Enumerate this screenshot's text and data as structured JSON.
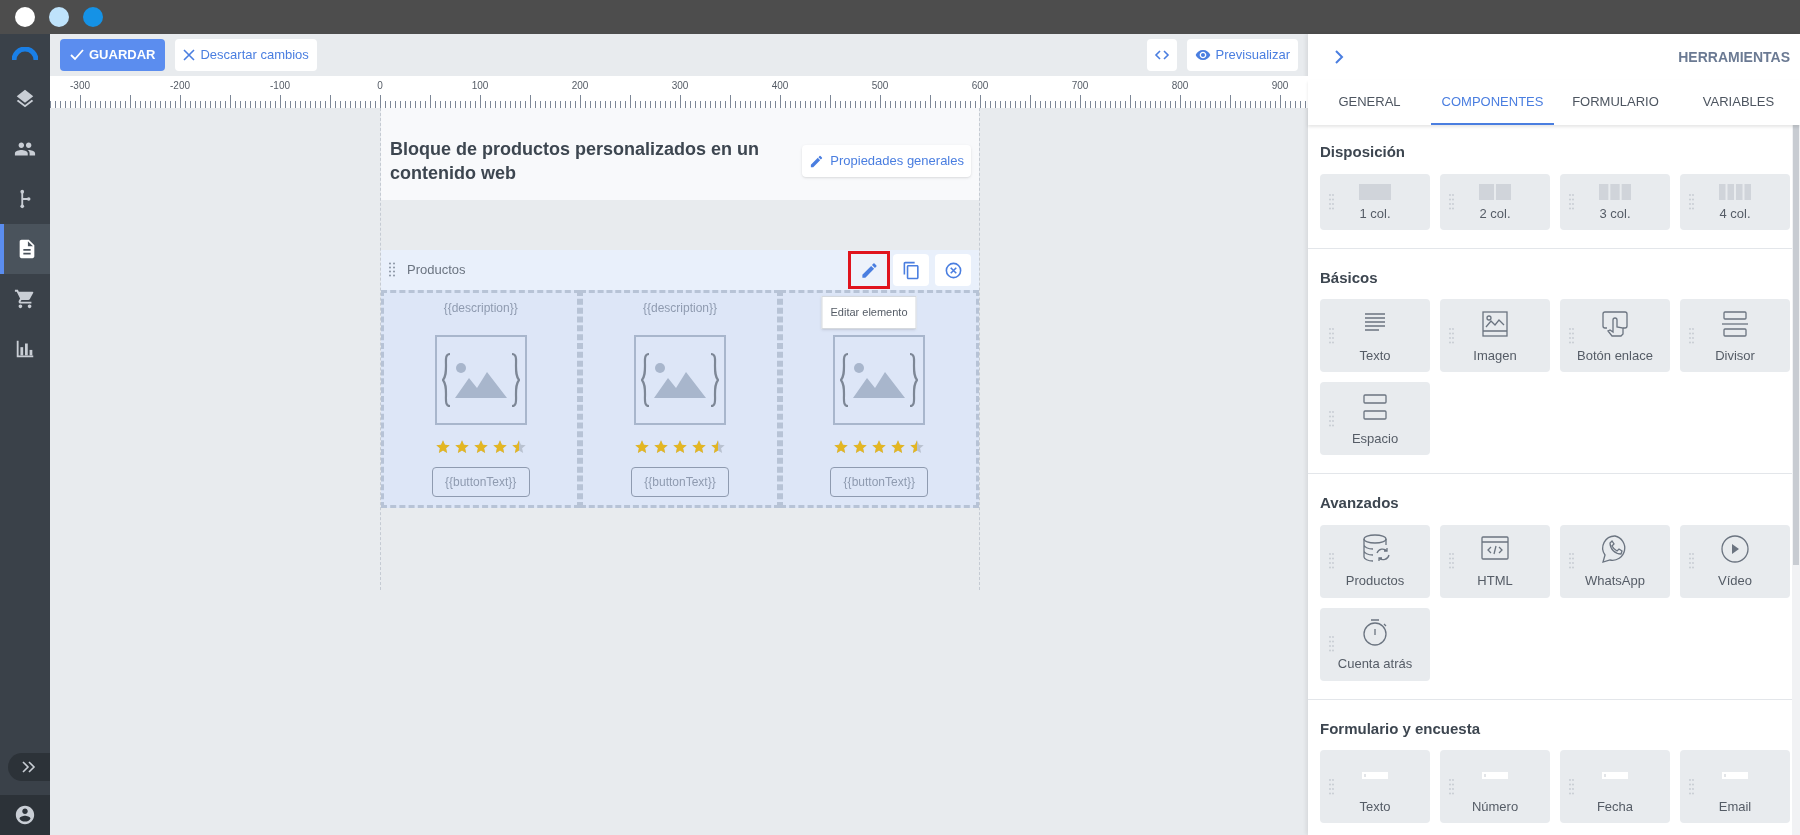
{
  "sidebar": {
    "items": [
      {
        "selected": false
      },
      {
        "selected": false
      },
      {
        "selected": false
      },
      {
        "selected": true
      },
      {
        "selected": false
      },
      {
        "selected": false
      }
    ]
  },
  "toolbar": {
    "save": "GUARDAR",
    "discard": "Descartar cambios",
    "preview": "Previsualizar"
  },
  "ruler": {
    "labels": [
      "-300",
      "-200",
      "-100",
      "0",
      "100",
      "200",
      "300",
      "400",
      "500",
      "600",
      "700",
      "800",
      "900"
    ]
  },
  "page": {
    "title": "Bloque de productos personalizados en un contenido web",
    "properties_button": "Propiedades generales",
    "element": {
      "label": "Productos",
      "tooltip": "Editar elemento",
      "actions": [
        {
          "kind": "edit",
          "highlighted": true
        },
        {
          "kind": "copy",
          "highlighted": false
        },
        {
          "kind": "delete",
          "highlighted": false
        }
      ],
      "products": [
        {
          "description": "{{description}}",
          "stars": 4.5,
          "button": "{{buttonText}}"
        },
        {
          "description": "{{description}}",
          "stars": 4.5,
          "button": "{{buttonText}}"
        },
        {
          "stars": 4.5,
          "button": "{{buttonText}}"
        }
      ]
    }
  },
  "panel": {
    "title": "HERRAMIENTAS",
    "tabs": [
      {
        "label": "GENERAL",
        "selected": false
      },
      {
        "label": "COMPONENTES",
        "selected": true
      },
      {
        "label": "FORMULARIO",
        "selected": false
      },
      {
        "label": "VARIABLES",
        "selected": false
      }
    ],
    "sections": [
      {
        "title": "Disposición",
        "tiles": [
          "1 col.",
          "2 col.",
          "3 col.",
          "4 col."
        ]
      },
      {
        "title": "Básicos",
        "tiles": [
          "Texto",
          "Imagen",
          "Botón enlace",
          "Divisor",
          "Espacio"
        ]
      },
      {
        "title": "Avanzados",
        "tiles": [
          "Productos",
          "HTML",
          "WhatsApp",
          "Vídeo",
          "Cuenta atrás"
        ]
      },
      {
        "title": "Formulario y encuesta",
        "tiles": [
          "Texto",
          "Número",
          "Fecha",
          "Email"
        ]
      }
    ]
  }
}
